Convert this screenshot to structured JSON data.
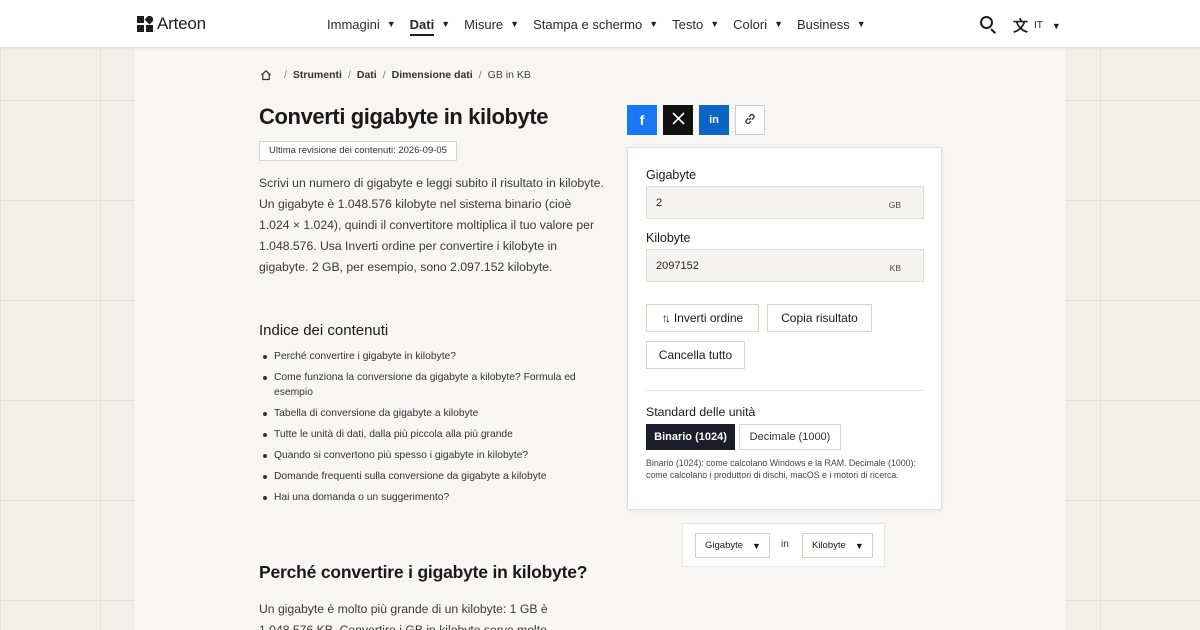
{
  "header": {
    "brand": "Arteon",
    "nav": [
      {
        "label": "Immagini",
        "active": false
      },
      {
        "label": "Dati",
        "active": true
      },
      {
        "label": "Misure",
        "active": false
      },
      {
        "label": "Stampa e schermo",
        "active": false
      },
      {
        "label": "Testo",
        "active": false
      },
      {
        "label": "Colori",
        "active": false
      },
      {
        "label": "Business",
        "active": false
      }
    ],
    "language": "IT"
  },
  "breadcrumb": {
    "items": [
      "Strumenti",
      "Dati",
      "Dimensione dati"
    ],
    "current": "GB in KB"
  },
  "page": {
    "title": "Converti gigabyte in kilobyte",
    "revision": "Ultima revisione dei contenuti: 2026-09-05",
    "intro": "Scrivi un numero di gigabyte e leggi subito il risultato in kilobyte. Un gigabyte è 1.048.576 kilobyte nel sistema binario (cioè 1.024 × 1.024), quindi il convertitore moltiplica il tuo valore per 1.048.576. Usa Inverti ordine per convertire i kilobyte in gigabyte. 2 GB, per esempio, sono 2.097.152 kilobyte.",
    "toc_title": "Indice dei contenuti",
    "toc": [
      "Perché convertire i gigabyte in kilobyte?",
      "Come funziona la conversione da gigabyte a kilobyte? Formula ed esempio",
      "Tabella di conversione da gigabyte a kilobyte",
      "Tutte le unità di dati, dalla più piccola alla più grande",
      "Quando si convertono più spesso i gigabyte in kilobyte?",
      "Domande frequenti sulla conversione da gigabyte a kilobyte",
      "Hai una domanda o un suggerimento?"
    ],
    "section_title": "Perché convertire i gigabyte in kilobyte?",
    "section_text": "Un gigabyte è molto più grande di un kilobyte: 1 GB è 1.048.576 KB. Convertire i GB in kilobyte serve molto"
  },
  "share": {
    "facebook": "f",
    "x": "𝕏",
    "linkedin": "in",
    "link_icon": "link-icon"
  },
  "converter": {
    "from_label": "Gigabyte",
    "from_value": "2",
    "from_unit": "GB",
    "to_label": "Kilobyte",
    "to_value": "2097152",
    "to_unit": "KB",
    "swap_label": "Inverti ordine",
    "copy_label": "Copia risultato",
    "clear_label": "Cancella tutto",
    "standard_label": "Standard delle unità",
    "binary_label": "Binario (1024)",
    "decimal_label": "Decimale (1000)",
    "note": "Binario (1024): come calcolano Windows e la RAM. Decimale (1000): come calcolano i produttori di dischi, macOS e i motori di ricerca."
  },
  "selector": {
    "from": "Gigabyte",
    "connector": "in",
    "to": "Kilobyte"
  },
  "colors": {
    "accent_dark": "#1c1d2b",
    "facebook": "#1877f2",
    "linkedin": "#0a66c2"
  }
}
